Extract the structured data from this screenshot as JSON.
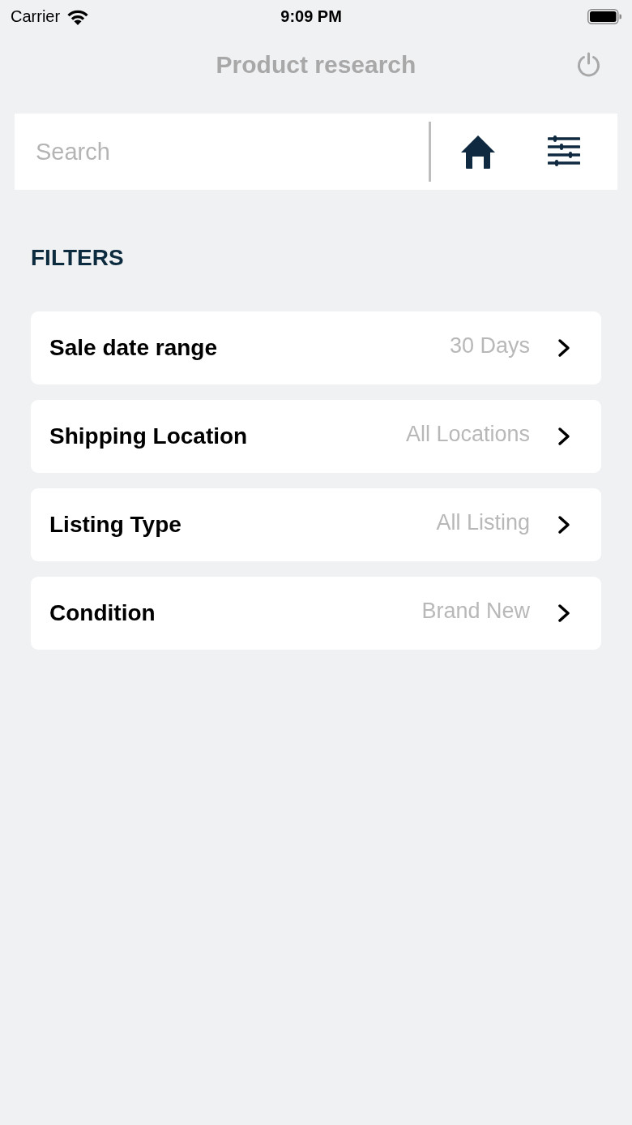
{
  "status_bar": {
    "carrier": "Carrier",
    "time": "9:09 PM"
  },
  "header": {
    "title": "Product research"
  },
  "search": {
    "placeholder": "Search"
  },
  "filters": {
    "heading": "FILTERS",
    "items": [
      {
        "label": "Sale date range",
        "value": "30 Days"
      },
      {
        "label": "Shipping Location",
        "value": "All Locations"
      },
      {
        "label": "Listing Type",
        "value": "All Listing"
      },
      {
        "label": "Condition",
        "value": "Brand New"
      }
    ]
  }
}
